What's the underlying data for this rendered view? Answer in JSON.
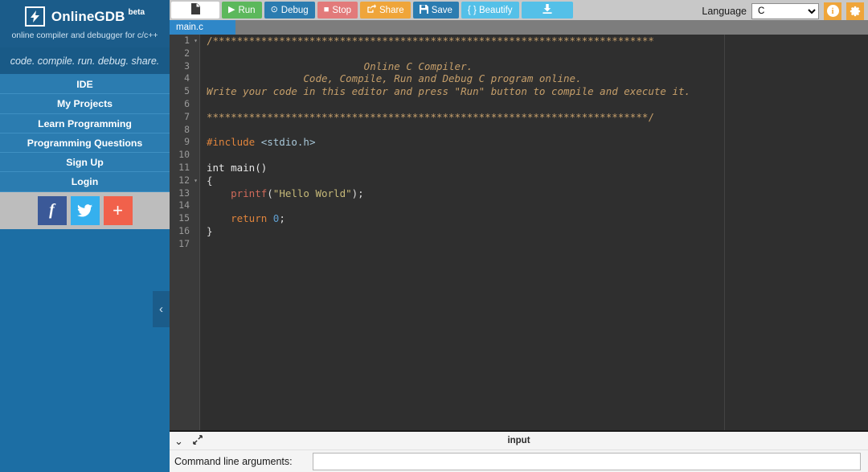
{
  "sidebar": {
    "brand": {
      "name": "OnlineGDB",
      "beta": "beta",
      "logo_icon": "lightning-bolt-icon",
      "subtitle": "online compiler and debugger for c/c++"
    },
    "tagline": "code. compile. run. debug. share.",
    "nav_items": [
      {
        "label": "IDE"
      },
      {
        "label": "My Projects"
      },
      {
        "label": "Learn Programming"
      },
      {
        "label": "Programming Questions"
      },
      {
        "label": "Sign Up"
      },
      {
        "label": "Login"
      }
    ],
    "social": [
      {
        "name": "facebook-share-button",
        "glyph": "f"
      },
      {
        "name": "twitter-share-button",
        "glyph": "🐦"
      },
      {
        "name": "more-share-button",
        "glyph": "+"
      }
    ],
    "collapse_glyph": "‹",
    "colors": {
      "brand_dark": "#1b5c8a",
      "brand": "#1c6ea4",
      "nav": "#2b7cb0"
    }
  },
  "toolbar": {
    "new_file_label": "",
    "buttons": [
      {
        "id": "run",
        "label": "Run",
        "icon": "play-icon",
        "glyph": "▶",
        "color": "#5cb85c"
      },
      {
        "id": "debug",
        "label": "Debug",
        "icon": "debug-icon",
        "glyph": "⊙",
        "color": "#2b7cb0"
      },
      {
        "id": "stop",
        "label": "Stop",
        "icon": "stop-icon",
        "glyph": "■",
        "color": "#e27a7a"
      },
      {
        "id": "share",
        "label": "Share",
        "icon": "share-icon",
        "glyph": "↪",
        "color": "#efa53a"
      },
      {
        "id": "save",
        "label": "Save",
        "icon": "floppy-disk-icon",
        "glyph": "💾",
        "color": "#2b7cb0"
      },
      {
        "id": "beautify",
        "label": "{ } Beautify",
        "icon": "braces-icon",
        "glyph": "",
        "color": "#54c0e8"
      },
      {
        "id": "download",
        "label": "",
        "icon": "download-icon",
        "glyph": "⬇",
        "color": "#54c0e8"
      }
    ],
    "language_label": "Language",
    "language_value": "C",
    "language_options": [
      "C"
    ],
    "info_icon": "info-icon",
    "info_glyph": "i",
    "settings_icon": "gear-icon",
    "settings_glyph": "⚙"
  },
  "tabs": [
    {
      "label": "main.c",
      "active": true
    }
  ],
  "editor": {
    "line_count": 17,
    "fold_lines": [
      1,
      12
    ],
    "lines": [
      {
        "n": 1,
        "tokens": [
          {
            "t": "/*************************************************************************",
            "c": "cmt-plain"
          }
        ]
      },
      {
        "n": 2,
        "tokens": []
      },
      {
        "n": 3,
        "tokens": [
          {
            "t": "                          Online C Compiler.",
            "c": "cmt"
          }
        ]
      },
      {
        "n": 4,
        "tokens": [
          {
            "t": "                Code, Compile, Run and Debug C program online.",
            "c": "cmt"
          }
        ]
      },
      {
        "n": 5,
        "tokens": [
          {
            "t": "Write your code in this editor and press \"Run\" button to compile and execute it.",
            "c": "cmt"
          }
        ]
      },
      {
        "n": 6,
        "tokens": []
      },
      {
        "n": 7,
        "tokens": [
          {
            "t": "*************************************************************************/",
            "c": "cmt-plain"
          }
        ]
      },
      {
        "n": 8,
        "tokens": []
      },
      {
        "n": 9,
        "tokens": [
          {
            "t": "#include ",
            "c": "pre"
          },
          {
            "t": "<stdio.h>",
            "c": "inc"
          }
        ]
      },
      {
        "n": 10,
        "tokens": []
      },
      {
        "n": 11,
        "tokens": [
          {
            "t": "int main()",
            "c": "kw"
          }
        ]
      },
      {
        "n": 12,
        "tokens": [
          {
            "t": "{",
            "c": "punc"
          }
        ]
      },
      {
        "n": 13,
        "tokens": [
          {
            "t": "    printf",
            "c": "fn"
          },
          {
            "t": "(",
            "c": "punc"
          },
          {
            "t": "\"Hello World\"",
            "c": "str"
          },
          {
            "t": ");",
            "c": "punc"
          }
        ]
      },
      {
        "n": 14,
        "tokens": []
      },
      {
        "n": 15,
        "tokens": [
          {
            "t": "    return ",
            "c": "pre"
          },
          {
            "t": "0",
            "c": "num"
          },
          {
            "t": ";",
            "c": "punc"
          }
        ]
      },
      {
        "n": 16,
        "tokens": [
          {
            "t": "}",
            "c": "punc"
          }
        ]
      },
      {
        "n": 17,
        "tokens": []
      }
    ],
    "colors": {
      "background": "#2f2f2f",
      "gutter": "#3a3a3a",
      "comment": "#c69f6a",
      "string": "#c6b978",
      "function": "#cf6a5a",
      "number": "#5f9ecf",
      "preproc": "#e0843c"
    }
  },
  "bottom_panel": {
    "title": "input",
    "collapse_glyph": "⌄",
    "collapse_icon": "chevron-down-icon",
    "expand_glyph": "⤡",
    "expand_icon": "expand-icon",
    "cla_label": "Command line arguments:",
    "cla_value": "",
    "cla_placeholder": ""
  }
}
